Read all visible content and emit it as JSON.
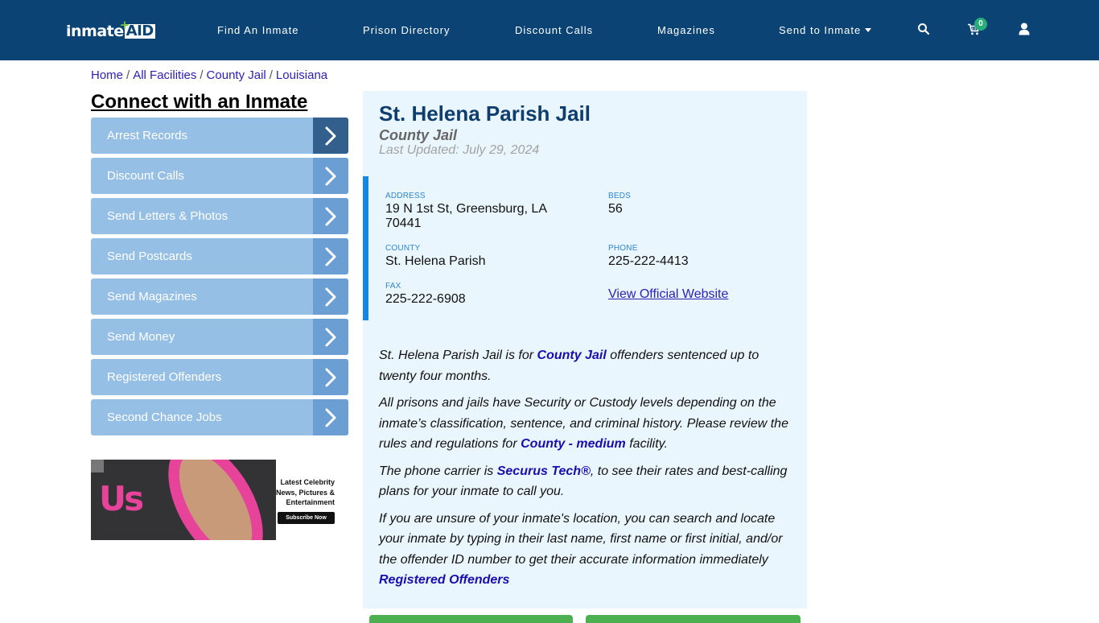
{
  "brand": {
    "logo_text": "inmate",
    "logo_accent": "AID",
    "logo_plus": "+"
  },
  "nav": {
    "items": [
      {
        "label": "Find An Inmate"
      },
      {
        "label": "Prison Directory"
      },
      {
        "label": "Discount Calls"
      },
      {
        "label": "Magazines"
      },
      {
        "label": "Send to Inmate"
      }
    ],
    "icons": [
      "search-icon",
      "cart-icon",
      "user-icon"
    ],
    "cart_count": "0"
  },
  "breadcrumb": [
    {
      "label": "Home"
    },
    {
      "label": "All Facilities"
    },
    {
      "label": "County Jail"
    },
    {
      "label": "Louisiana"
    }
  ],
  "breadcrumb_separator": "/",
  "sidebar": {
    "title": "Connect with an Inmate",
    "items": [
      {
        "label": "Arrest Records"
      },
      {
        "label": "Discount Calls"
      },
      {
        "label": "Send Letters & Photos"
      },
      {
        "label": "Send Postcards"
      },
      {
        "label": "Send Magazines"
      },
      {
        "label": "Send Money"
      },
      {
        "label": "Registered Offenders"
      },
      {
        "label": "Second Chance Jobs"
      }
    ],
    "ad": {
      "brand": "Us",
      "headline": "Latest Celebrity News, Pictures & Entertainment",
      "button": "Subscribe Now"
    }
  },
  "facility": {
    "name": "St. Helena Parish Jail",
    "type": "County Jail",
    "last_updated": "Last Updated: July 29, 2024",
    "fields": {
      "address_label": "ADDRESS",
      "address": "19 N 1st St, Greensburg, LA 70441",
      "beds_label": "BEDS",
      "beds": "56",
      "county_label": "COUNTY",
      "county": "St. Helena Parish",
      "phone_label": "PHONE",
      "phone": "225-222-4413",
      "fax_label": "FAX",
      "fax": "225-222-6908",
      "website_link": "View Official Website"
    },
    "description": {
      "p1_pre": "St. Helena Parish Jail is for ",
      "p1_link": "County Jail",
      "p1_post": " offenders sentenced up to twenty four months.",
      "p2_pre": "All prisons and jails have Security or Custody levels depending on the inmate’s classification, sentence, and criminal history. Please review the rules and regulations for ",
      "p2_link": "County - medium",
      "p2_post": " facility.",
      "p3_pre": "The phone carrier is ",
      "p3_link": "Securus Tech®",
      "p3_post": ", to see their rates and best-calling plans for your inmate to call you.",
      "p4_pre": "If you are unsure of your inmate's location, you can search and locate your inmate by typing in their last name, first name or first initial, and/or the offender ID number to get their accurate information immediately ",
      "p4_link": "Registered Offenders"
    }
  },
  "colors": {
    "navbar": "#0b4375",
    "menu_item": "#96bfe6",
    "menu_arrow": "#6b9fd3",
    "menu_arrow_active": "#335f8c",
    "panel_bg": "#eaf6fd",
    "accent_bar": "#1486e6",
    "link": "#1a0db0",
    "green_button": "#4caf50"
  }
}
